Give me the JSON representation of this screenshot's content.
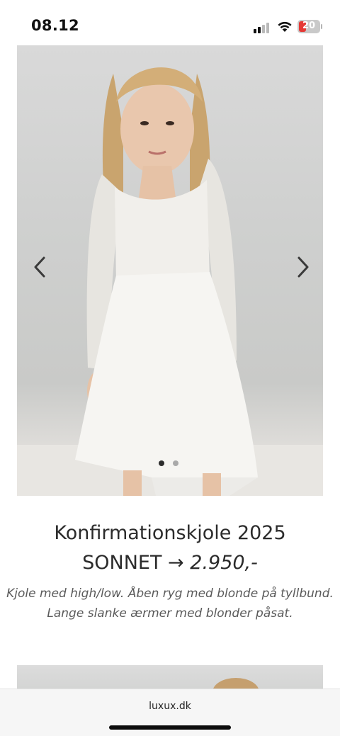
{
  "status_bar": {
    "time": "08.12",
    "battery_level": "20",
    "icons": [
      "signal-icon",
      "wifi-icon",
      "battery-icon"
    ],
    "battery_color": "#e53935"
  },
  "gallery": {
    "icons": [
      "chevron-left-icon",
      "chevron-right-icon"
    ],
    "slide_count": 2,
    "active_slide": 1
  },
  "product": {
    "title": "Konfirmationskjole 2025",
    "name": "SONNET",
    "arrow": "→",
    "price": "2.950,-",
    "description_line1": "Kjole med high/low. Åben ryg med blonde på tyllbund.",
    "description_line2": "Lange slanke ærmer med blonder påsat."
  },
  "browser": {
    "url": "luxux.dk"
  }
}
